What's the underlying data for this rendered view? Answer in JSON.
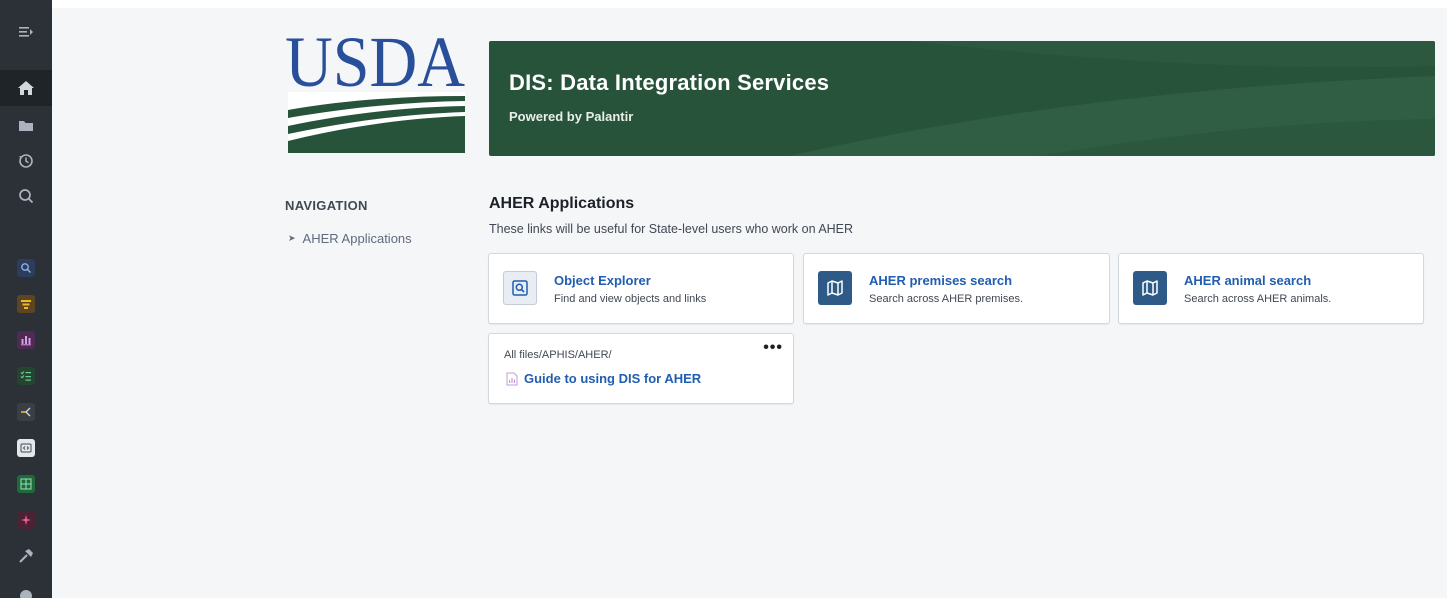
{
  "banner": {
    "title": "DIS: Data Integration Services",
    "subtitle": "Powered by Palantir",
    "color": "#27533b"
  },
  "logo": {
    "text": "USDA",
    "text_color": "#2a4f9a",
    "field_color": "#27533b"
  },
  "navigation": {
    "heading": "NAVIGATION",
    "items": [
      {
        "label": "AHER Applications"
      }
    ]
  },
  "section": {
    "title": "AHER Applications",
    "description": "These links will be useful for State-level users who work on AHER"
  },
  "cards": [
    {
      "title": "Object Explorer",
      "description": "Find and view objects and links",
      "icon": "object-explorer-icon"
    },
    {
      "title": "AHER premises search",
      "description": "Search across AHER premises.",
      "icon": "map-icon"
    },
    {
      "title": "AHER animal search",
      "description": "Search across AHER animals.",
      "icon": "map-icon"
    }
  ],
  "file_card": {
    "path": "All files/APHIS/AHER/",
    "name": "Guide to using DIS for AHER",
    "more": "•••",
    "icon": "report-file-icon"
  },
  "rail": {
    "icons": [
      "collapse-icon",
      "home-icon",
      "folder-icon",
      "history-icon",
      "search-icon",
      "object-explorer-app-icon",
      "filter-app-icon",
      "chart-app-icon",
      "checklist-app-icon",
      "pipeline-app-icon",
      "code-workspace-app-icon",
      "dashboard-app-icon",
      "ai-sparkle-app-icon",
      "hammer-icon",
      "more-icon"
    ],
    "accent_colors": {
      "object_explorer": "#4a6fa5",
      "filter": "#d99e0b",
      "chart": "#9d3f9d",
      "checklist": "#238551",
      "pipeline": "#c87619",
      "code": "#5f6b7c",
      "dashboard": "#238551",
      "ai": "#cd4246"
    }
  }
}
